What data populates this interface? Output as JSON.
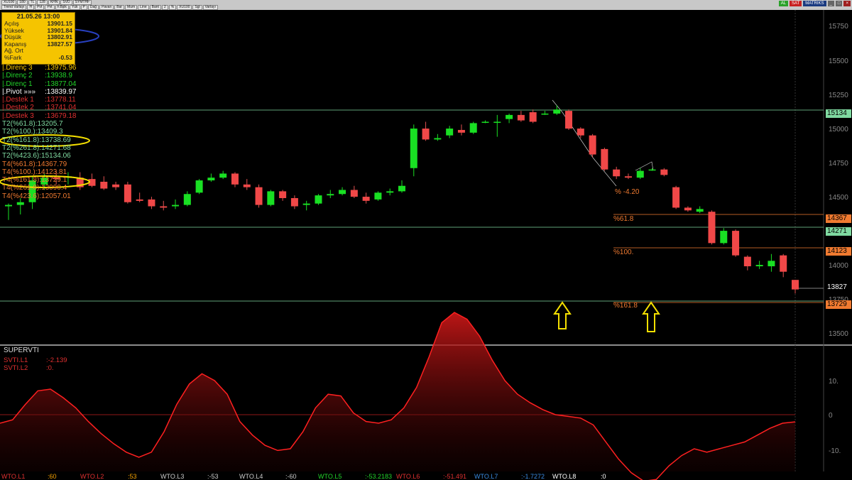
{
  "toolbar": {
    "row1": [
      "XU100",
      "180",
      "TL",
      "128",
      "KHN",
      "SVD",
      "SYMTHF"
    ],
    "row2": [
      "Trend Varlayı",
      "H",
      "Pvt",
      "Pvt",
      "F.Bşlk",
      "Yük",
      "P",
      "Dağ",
      "Pavan",
      "Bar",
      "Mum",
      "Line",
      "Bant",
      "2",
      "%",
      "XU100",
      "Sgl",
      "Varlayı"
    ],
    "buy_label": "AL",
    "sell_label": "SAT",
    "brand": "MATRIKS"
  },
  "infobox": {
    "date": "21.05.26 13:00",
    "rows": [
      {
        "label": "Açılış",
        "value": "13901.15"
      },
      {
        "label": "Yüksek",
        "value": "13901.84"
      },
      {
        "label": "Düşük",
        "value": "13802.91"
      },
      {
        "label": "Kapanış",
        "value": "13827.57"
      },
      {
        "label": "Ağ. Ort",
        "value": ""
      },
      {
        "label": "%Fark",
        "value": "-0.53"
      }
    ]
  },
  "levels": [
    {
      "label": "|.Direnç 3",
      "value": ":13975.96",
      "color": "#f5c400"
    },
    {
      "label": "|.Direnç 2",
      "value": ":13938.9",
      "color": "#22d42a"
    },
    {
      "label": "|.Direnç 1",
      "value": ":13877.04",
      "color": "#22d42a"
    },
    {
      "label": "|.Pivot  »»»",
      "value": ":13839.97",
      "color": "#ffffff"
    },
    {
      "label": "|.Destek 1",
      "value": ":13778.11",
      "color": "#e03030"
    },
    {
      "label": "|.Destek 2",
      "value": ":13741.04",
      "color": "#e03030"
    },
    {
      "label": "|.Destek 3",
      "value": ":13679.18",
      "color": "#e03030"
    },
    {
      "label": "T2(%61.8)",
      "value": ":13205.7",
      "color": "#7fd9a0"
    },
    {
      "label": "T2(%100.)",
      "value": ":13409.3",
      "color": "#7fd9a0"
    },
    {
      "label": "T2(%161.8)",
      "value": ":13738.69",
      "color": "#7fd9a0"
    },
    {
      "label": "T2(%261.8)",
      "value": ":14271.68",
      "color": "#7fd9a0"
    },
    {
      "label": "T2(%423.6)",
      "value": ":15134.06",
      "color": "#7fd9a0"
    },
    {
      "label": "T4(%61.8)",
      "value": ":14367.79",
      "color": "#f07a30"
    },
    {
      "label": "T4(%100.)",
      "value": ":14123.81",
      "color": "#f07a30"
    },
    {
      "label": "T4(%161.8)",
      "value": ":13729.1",
      "color": "#f07a30"
    },
    {
      "label": "T4(%261.8)",
      "value": ":13090.4",
      "color": "#f07a30"
    },
    {
      "label": "T4(%423.6)",
      "value": ":12057.01",
      "color": "#f07a30"
    }
  ],
  "price_axis": {
    "ticks": [
      "15750",
      "15500",
      "15250",
      "15000",
      "14750",
      "14500",
      "14000",
      "13750",
      "13500"
    ],
    "tags": [
      {
        "text": "15134",
        "color": "#7fd9a0",
        "fg": "#000000"
      },
      {
        "text": "14367",
        "color": "#f07a30",
        "fg": "#000000"
      },
      {
        "text": "14271",
        "color": "#7fd9a0",
        "fg": "#000000"
      },
      {
        "text": "14123",
        "color": "#f07a30",
        "fg": "#000000"
      },
      {
        "text": "13827",
        "color": "#000000",
        "fg": "#ffffff"
      },
      {
        "text": "13729",
        "color": "#f07a30",
        "fg": "#000000"
      }
    ]
  },
  "fib_labels": {
    "pct_neg": "% -4.20",
    "pct_618": "%61.8",
    "pct_100": "%100.",
    "pct_1618": "%161.8"
  },
  "indicator": {
    "title": "SUPERVTI",
    "l1_label": "SVTI.L1",
    "l1_value": ":-2.139",
    "l2_label": "SVTI.L2",
    "l2_value": ":0.",
    "axis": [
      "10.",
      "0",
      "-10."
    ]
  },
  "bottom_bar": [
    {
      "text": "WTO.L1",
      "color": "#e03030"
    },
    {
      "text": ":60",
      "color": "#f5a000"
    },
    {
      "text": "WTO.L2",
      "color": "#e03030"
    },
    {
      "text": ":53",
      "color": "#f5a000"
    },
    {
      "text": "WTO.L3",
      "color": "#cccccc"
    },
    {
      "text": ":-53",
      "color": "#cccccc"
    },
    {
      "text": "WTO.L4",
      "color": "#cccccc"
    },
    {
      "text": ":-60",
      "color": "#cccccc"
    },
    {
      "text": "WTO.L5",
      "color": "#22d42a"
    },
    {
      "text": ":-53.2183",
      "color": "#22d42a"
    },
    {
      "text": "WTO.L6",
      "color": "#e03030"
    },
    {
      "text": ":-51.491",
      "color": "#e03030"
    },
    {
      "text": "WTO.L7",
      "color": "#3a8ae0"
    },
    {
      "text": ":-1.7272",
      "color": "#3a8ae0"
    },
    {
      "text": "WTO.L8",
      "color": "#ffffff"
    },
    {
      "text": ":0",
      "color": "#ffffff"
    }
  ],
  "chart_data": {
    "type": "candlestick",
    "candles": [
      {
        "o": 14440,
        "h": 14460,
        "l": 14340,
        "c": 14450
      },
      {
        "o": 14450,
        "h": 14500,
        "l": 14380,
        "c": 14470
      },
      {
        "o": 14470,
        "h": 14660,
        "l": 14420,
        "c": 14630
      },
      {
        "o": 14600,
        "h": 14680,
        "l": 14560,
        "c": 14650
      },
      {
        "o": 14650,
        "h": 14700,
        "l": 14600,
        "c": 14640
      },
      {
        "o": 14650,
        "h": 14690,
        "l": 14600,
        "c": 14660
      },
      {
        "o": 14650,
        "h": 14690,
        "l": 14560,
        "c": 14580
      },
      {
        "o": 14640,
        "h": 14680,
        "l": 14580,
        "c": 14590
      },
      {
        "o": 14620,
        "h": 14660,
        "l": 14560,
        "c": 14570
      },
      {
        "o": 14600,
        "h": 14620,
        "l": 14560,
        "c": 14580
      },
      {
        "o": 14600,
        "h": 14620,
        "l": 14460,
        "c": 14470
      },
      {
        "o": 14490,
        "h": 14540,
        "l": 14470,
        "c": 14480
      },
      {
        "o": 14490,
        "h": 14510,
        "l": 14420,
        "c": 14440
      },
      {
        "o": 14440,
        "h": 14480,
        "l": 14410,
        "c": 14430
      },
      {
        "o": 14440,
        "h": 14490,
        "l": 14420,
        "c": 14450
      },
      {
        "o": 14450,
        "h": 14550,
        "l": 14440,
        "c": 14530
      },
      {
        "o": 14540,
        "h": 14640,
        "l": 14530,
        "c": 14630
      },
      {
        "o": 14630,
        "h": 14680,
        "l": 14620,
        "c": 14650
      },
      {
        "o": 14650,
        "h": 14700,
        "l": 14640,
        "c": 14680
      },
      {
        "o": 14680,
        "h": 14690,
        "l": 14580,
        "c": 14600
      },
      {
        "o": 14600,
        "h": 14640,
        "l": 14560,
        "c": 14580
      },
      {
        "o": 14580,
        "h": 14600,
        "l": 14430,
        "c": 14450
      },
      {
        "o": 14450,
        "h": 14560,
        "l": 14440,
        "c": 14550
      },
      {
        "o": 14550,
        "h": 14560,
        "l": 14480,
        "c": 14500
      },
      {
        "o": 14500,
        "h": 14520,
        "l": 14420,
        "c": 14440
      },
      {
        "o": 14450,
        "h": 14480,
        "l": 14410,
        "c": 14460
      },
      {
        "o": 14460,
        "h": 14530,
        "l": 14450,
        "c": 14520
      },
      {
        "o": 14520,
        "h": 14560,
        "l": 14500,
        "c": 14530
      },
      {
        "o": 14530,
        "h": 14580,
        "l": 14520,
        "c": 14560
      },
      {
        "o": 14560,
        "h": 14590,
        "l": 14500,
        "c": 14510
      },
      {
        "o": 14510,
        "h": 14540,
        "l": 14460,
        "c": 14480
      },
      {
        "o": 14490,
        "h": 14550,
        "l": 14480,
        "c": 14540
      },
      {
        "o": 14540,
        "h": 14570,
        "l": 14520,
        "c": 14550
      },
      {
        "o": 14550,
        "h": 14630,
        "l": 14540,
        "c": 14590
      },
      {
        "o": 14720,
        "h": 15040,
        "l": 14660,
        "c": 15010
      },
      {
        "o": 15010,
        "h": 15060,
        "l": 14920,
        "c": 14930
      },
      {
        "o": 14930,
        "h": 14970,
        "l": 14920,
        "c": 14940
      },
      {
        "o": 14960,
        "h": 15030,
        "l": 14940,
        "c": 15010
      },
      {
        "o": 15000,
        "h": 15040,
        "l": 14960,
        "c": 14980
      },
      {
        "o": 14980,
        "h": 15060,
        "l": 14970,
        "c": 15050
      },
      {
        "o": 15060,
        "h": 15070,
        "l": 15050,
        "c": 15060
      },
      {
        "o": 15060,
        "h": 15110,
        "l": 14950,
        "c": 15060
      },
      {
        "o": 15080,
        "h": 15120,
        "l": 15050,
        "c": 15110
      },
      {
        "o": 15110,
        "h": 15140,
        "l": 15060,
        "c": 15070
      },
      {
        "o": 15130,
        "h": 15150,
        "l": 15050,
        "c": 15060
      },
      {
        "o": 15120,
        "h": 15140,
        "l": 15110,
        "c": 15120
      },
      {
        "o": 15120,
        "h": 15180,
        "l": 15110,
        "c": 15150
      },
      {
        "o": 15140,
        "h": 15150,
        "l": 15000,
        "c": 15010
      },
      {
        "o": 15010,
        "h": 15020,
        "l": 14940,
        "c": 14960
      },
      {
        "o": 14960,
        "h": 14970,
        "l": 14800,
        "c": 14820
      },
      {
        "o": 14860,
        "h": 14870,
        "l": 14700,
        "c": 14710
      },
      {
        "o": 14710,
        "h": 14730,
        "l": 14640,
        "c": 14660
      },
      {
        "o": 14660,
        "h": 14680,
        "l": 14640,
        "c": 14650
      },
      {
        "o": 14650,
        "h": 14720,
        "l": 14640,
        "c": 14700
      },
      {
        "o": 14710,
        "h": 14720,
        "l": 14700,
        "c": 14710
      },
      {
        "o": 14710,
        "h": 14720,
        "l": 14660,
        "c": 14670
      },
      {
        "o": 14580,
        "h": 14590,
        "l": 14420,
        "c": 14430
      },
      {
        "o": 14430,
        "h": 14440,
        "l": 14400,
        "c": 14410
      },
      {
        "o": 14400,
        "h": 14440,
        "l": 14390,
        "c": 14420
      },
      {
        "o": 14400,
        "h": 14410,
        "l": 14160,
        "c": 14170
      },
      {
        "o": 14170,
        "h": 14280,
        "l": 14160,
        "c": 14260
      },
      {
        "o": 14260,
        "h": 14270,
        "l": 14070,
        "c": 14080
      },
      {
        "o": 14070,
        "h": 14080,
        "l": 13970,
        "c": 14000
      },
      {
        "o": 14000,
        "h": 14040,
        "l": 13980,
        "c": 14010
      },
      {
        "o": 14000,
        "h": 14090,
        "l": 13960,
        "c": 14040
      },
      {
        "o": 14080,
        "h": 14090,
        "l": 13920,
        "c": 13960
      },
      {
        "o": 13900,
        "h": 13900,
        "l": 13800,
        "c": 13830
      }
    ],
    "svti_l1": [
      -2.5,
      -1.5,
      3,
      7,
      7.5,
      5,
      2,
      -2,
      -5.5,
      -8.5,
      -11,
      -12.5,
      -11,
      -5,
      3,
      9,
      12,
      10,
      6,
      -2,
      -6,
      -9,
      -10.5,
      -10,
      -5,
      2,
      6,
      5.5,
      0.5,
      -2,
      -2.5,
      -1.5,
      2,
      8,
      17,
      27,
      30,
      28,
      23,
      16,
      10,
      6,
      3.5,
      1.5,
      0,
      -0.5,
      -1,
      -3,
      -8,
      -13,
      -17,
      -19.5,
      -19,
      -15,
      -12,
      -10,
      -11,
      -10,
      -9,
      -8,
      -6,
      -4,
      -2.5,
      -2.1
    ],
    "svti_l2": 0
  }
}
